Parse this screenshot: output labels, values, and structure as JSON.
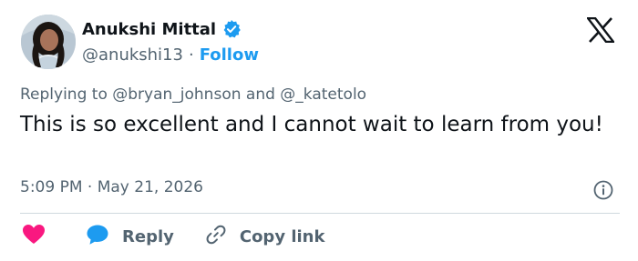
{
  "author": {
    "display_name": "Anukshi Mittal",
    "handle": "@anukshi13",
    "separator": "·",
    "follow_label": "Follow"
  },
  "tweet": {
    "replying_prefix": "Replying to",
    "replying_to_1": "@bryan_johnson",
    "replying_joiner": "and",
    "replying_to_2": "@_katetolo",
    "text": "This is so excellent and I cannot wait to learn from you!",
    "timestamp": "5:09 PM · May 21, 2026"
  },
  "actions": {
    "reply_label": "Reply",
    "copy_link_label": "Copy link"
  },
  "colors": {
    "accent": "#1d9bf0",
    "like": "#f91880",
    "secondary_text": "#536471"
  },
  "icons": [
    "verified-badge-icon",
    "x-logo-icon",
    "info-icon",
    "heart-icon",
    "reply-bubble-icon",
    "link-icon"
  ]
}
